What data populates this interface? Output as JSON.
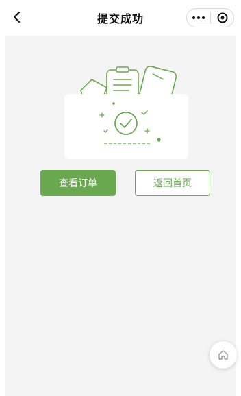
{
  "navbar": {
    "title": "提交成功",
    "back_icon": "chevron-left-icon",
    "capsule": {
      "more_icon": "more-dots-icon",
      "close_icon": "target-circle-icon"
    }
  },
  "actions": {
    "view_order_label": "查看订单",
    "back_home_label": "返回首页"
  },
  "floating": {
    "home_icon": "home-icon"
  },
  "colors": {
    "accent": "#6aa84f",
    "page_bg": "#f4f4f4"
  }
}
